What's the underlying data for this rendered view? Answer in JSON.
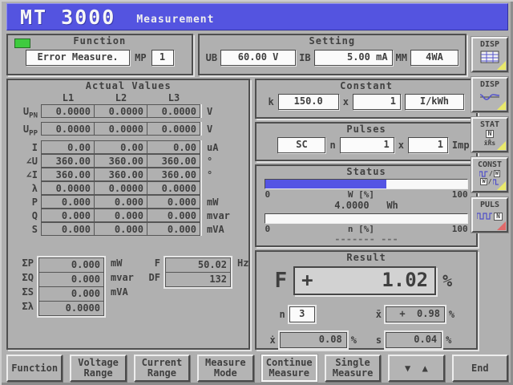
{
  "title": {
    "model": "MT 3000",
    "screen": "Measurement"
  },
  "function_group": {
    "title": "Function",
    "value": "Error Measure.",
    "mp_label": "MP",
    "mp_value": "1"
  },
  "setting": {
    "title": "Setting",
    "ub_label": "UB",
    "ub_value": "60.00 V",
    "ib_label": "IB",
    "ib_value": "5.00 mA",
    "mm_label": "MM",
    "mm_value": "4WA"
  },
  "actual": {
    "title": "Actual Values",
    "columns": [
      "L1",
      "L2",
      "L3"
    ],
    "rows": [
      {
        "label": "U",
        "sub": "PN",
        "v1": "0.0000",
        "v2": "0.0000",
        "v3": "0.0000",
        "unit": "V"
      },
      {
        "label": "U",
        "sub": "PP",
        "v1": "0.0000",
        "v2": "0.0000",
        "v3": "0.0000",
        "unit": "V"
      },
      {
        "label": "I",
        "sub": "",
        "v1": "0.00",
        "v2": "0.00",
        "v3": "0.00",
        "unit": "uA"
      },
      {
        "label": "∠U",
        "sub": "",
        "v1": "360.00",
        "v2": "360.00",
        "v3": "360.00",
        "unit": "°"
      },
      {
        "label": "∠I",
        "sub": "",
        "v1": "360.00",
        "v2": "360.00",
        "v3": "360.00",
        "unit": "°"
      },
      {
        "label": "λ",
        "sub": "",
        "v1": "0.0000",
        "v2": "0.0000",
        "v3": "0.0000",
        "unit": ""
      },
      {
        "label": "P",
        "sub": "",
        "v1": "0.000",
        "v2": "0.000",
        "v3": "0.000",
        "unit": "mW"
      },
      {
        "label": "Q",
        "sub": "",
        "v1": "0.000",
        "v2": "0.000",
        "v3": "0.000",
        "unit": "mvar"
      },
      {
        "label": "S",
        "sub": "",
        "v1": "0.000",
        "v2": "0.000",
        "v3": "0.000",
        "unit": "mVA"
      }
    ],
    "sums": [
      {
        "label": "ΣP",
        "value": "0.000",
        "unit": "mW"
      },
      {
        "label": "ΣQ",
        "value": "0.000",
        "unit": "mvar"
      },
      {
        "label": "ΣS",
        "value": "0.000",
        "unit": "mVA"
      },
      {
        "label": "Σλ",
        "value": "0.0000",
        "unit": ""
      }
    ],
    "freq": {
      "label": "F",
      "value": "50.02",
      "unit": "Hz"
    },
    "df": {
      "label": "DF",
      "value": "132"
    }
  },
  "constant": {
    "title": "Constant",
    "k_label": "k",
    "k_value": "150.0",
    "times": "x",
    "mult_value": "1",
    "unit_value": "I/kWh"
  },
  "pulses": {
    "title": "Pulses",
    "mode_value": "SC",
    "n_label": "n",
    "n_value": "1",
    "times": "x",
    "imp_value": "1",
    "imp_label": "Imp"
  },
  "status": {
    "title": "Status",
    "w_bar_percent": 60,
    "w_min": "0",
    "w_label": "W [%]",
    "w_max": "100",
    "energy_value": "4.0000",
    "energy_unit": "Wh",
    "n_bar_percent": 0,
    "n_min": "0",
    "n_label": "n [%]",
    "n_max": "100",
    "dashes": "------- ---"
  },
  "result": {
    "title": "Result",
    "f_label": "F",
    "f_sign": "+",
    "f_value": "1.02",
    "f_unit": "%",
    "n_label": "n",
    "n_value": "3",
    "mean_label": "x̄",
    "mean_value": "+  0.98",
    "mean_unit": "%",
    "xdot_label": "ẋ",
    "xdot_value": "0.08",
    "xdot_unit": "%",
    "s_label": "s",
    "s_value": "0.04",
    "s_unit": "%"
  },
  "side_buttons": [
    {
      "label": "DISP"
    },
    {
      "label": "DISP"
    },
    {
      "label": "STAT",
      "badge": "N",
      "subtext": "x̄R̄s"
    },
    {
      "label": "CONST",
      "slash": "/",
      "w_label": "W"
    },
    {
      "label": "PULS",
      "badge": "N"
    }
  ],
  "softkeys": [
    {
      "line1": "Function",
      "line2": "",
      "active": false
    },
    {
      "line1": "Voltage",
      "line2": "Range",
      "active": false
    },
    {
      "line1": "Current",
      "line2": "Range",
      "active": false
    },
    {
      "line1": "Measure",
      "line2": "Mode",
      "active": false
    },
    {
      "line1": "Continue",
      "line2": "Measure",
      "active": true
    },
    {
      "line1": "Single",
      "line2": "Measure",
      "active": false
    },
    {
      "line1": "▼  ▲",
      "line2": "",
      "active": false
    },
    {
      "line1": "End",
      "line2": "",
      "active": false
    }
  ],
  "colors": {
    "accent_blue": "#5454e0",
    "led_green": "#3ecb3e",
    "softkey_corner_yellow": "#e9e96a",
    "softkey_corner_red": "#e06a6a"
  }
}
